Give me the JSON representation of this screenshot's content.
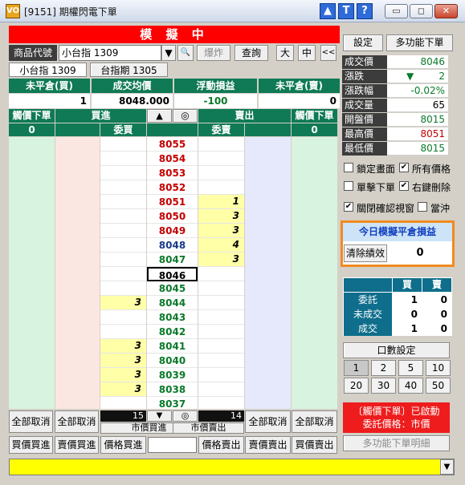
{
  "window": {
    "title": "[9151] 期權閃電下單",
    "logo": "VO",
    "help_icons": [
      "▲",
      "T",
      "?"
    ],
    "controls": [
      "▭",
      "◻",
      "✕"
    ]
  },
  "header": {
    "mode_label": "模 擬 中",
    "product_label": "商品代號",
    "product_value": "小台指 1309",
    "product_dropdown": "▼",
    "search_icon": "🔍",
    "explode_button": "爆炸",
    "query_button": "查詢",
    "size_buttons": [
      "大",
      "中",
      "<<"
    ],
    "tabs": [
      "小台指 1309",
      "台指期 1305"
    ]
  },
  "positions": {
    "headers": [
      "未平倉(買)",
      "成交均價",
      "浮動損益",
      "未平倉(賣)"
    ],
    "values": [
      "1",
      "8048.000",
      "-100",
      "0"
    ]
  },
  "ladder": {
    "left_headers": [
      "觸價下單",
      "買進"
    ],
    "mid_headers": [
      "▲",
      "◎"
    ],
    "right_headers": [
      "賣出",
      "觸價下單"
    ],
    "sub_left": [
      "0",
      "",
      "委買"
    ],
    "sub_right": [
      "委賣",
      "",
      "0"
    ],
    "rows": [
      {
        "price": "8055",
        "color": "#c40000",
        "bid": "",
        "ask": ""
      },
      {
        "price": "8054",
        "color": "#c40000",
        "bid": "",
        "ask": ""
      },
      {
        "price": "8053",
        "color": "#c40000",
        "bid": "",
        "ask": ""
      },
      {
        "price": "8052",
        "color": "#c40000",
        "bid": "",
        "ask": ""
      },
      {
        "price": "8051",
        "color": "#c40000",
        "bid": "",
        "ask": "1"
      },
      {
        "price": "8050",
        "color": "#c40000",
        "bid": "",
        "ask": "3"
      },
      {
        "price": "8049",
        "color": "#c40000",
        "bid": "",
        "ask": "3"
      },
      {
        "price": "8048",
        "color": "#1a3a8a",
        "bid": "",
        "ask": "4"
      },
      {
        "price": "8047",
        "color": "#0a7a2a",
        "bid": "",
        "ask": "3"
      },
      {
        "price": "8046",
        "color": "#000000",
        "bid": "",
        "ask": ""
      },
      {
        "price": "8045",
        "color": "#0a7a2a",
        "bid": "",
        "ask": ""
      },
      {
        "price": "8044",
        "color": "#0a7a2a",
        "bid": "3",
        "ask": ""
      },
      {
        "price": "8043",
        "color": "#0a7a2a",
        "bid": "",
        "ask": ""
      },
      {
        "price": "8042",
        "color": "#0a7a2a",
        "bid": "",
        "ask": ""
      },
      {
        "price": "8041",
        "color": "#0a7a2a",
        "bid": "3",
        "ask": ""
      },
      {
        "price": "8040",
        "color": "#0a7a2a",
        "bid": "3",
        "ask": ""
      },
      {
        "price": "8039",
        "color": "#0a7a2a",
        "bid": "3",
        "ask": ""
      },
      {
        "price": "8038",
        "color": "#0a7a2a",
        "bid": "3",
        "ask": ""
      },
      {
        "price": "8037",
        "color": "#0a7a2a",
        "bid": "",
        "ask": ""
      }
    ]
  },
  "bottom": {
    "cancel_all": "全部取消",
    "buy_total": "15",
    "sell_total": "14",
    "down_arrow": "▼",
    "center_icon": "◎",
    "market_buy": "市價買進",
    "market_sell": "市價賣出",
    "buy_buttons": [
      "買價買進",
      "賣價買進",
      "價格買進"
    ],
    "sell_buttons": [
      "價格賣出",
      "賣價賣出",
      "買價賣出"
    ],
    "price_input": ""
  },
  "right": {
    "settings_button": "設定",
    "multi_order_button": "多功能下單",
    "quote": [
      {
        "label": "成交價",
        "value": "8046",
        "color": "#0a7a2a"
      },
      {
        "label": "漲跌",
        "value": "2",
        "arrow": "▼",
        "color": "#0a7a2a"
      },
      {
        "label": "漲跌幅",
        "value": "-0.02%",
        "color": "#0a7a2a"
      },
      {
        "label": "成交量",
        "value": "65",
        "color": "#000000"
      },
      {
        "label": "開盤價",
        "value": "8015",
        "color": "#0a7a2a"
      },
      {
        "label": "最高價",
        "value": "8051",
        "color": "#c40000"
      },
      {
        "label": "最低價",
        "value": "8015",
        "color": "#0a7a2a"
      }
    ],
    "options": [
      {
        "label": "鎖定畫面",
        "checked": false
      },
      {
        "label": "所有價格",
        "checked": true
      },
      {
        "label": "單擊下單",
        "checked": false
      },
      {
        "label": "右鍵刪除",
        "checked": true
      },
      {
        "label": "關閉確認視窗",
        "checked": true
      },
      {
        "label": "當沖",
        "checked": false
      }
    ],
    "pnl_title": "今日模擬平倉損益",
    "clear_button": "清除績效",
    "pnl_value": "0",
    "stats_headers": [
      "買",
      "賣"
    ],
    "stats": [
      {
        "label": "委託",
        "buy": "1",
        "sell": "0"
      },
      {
        "label": "未成交",
        "buy": "0",
        "sell": "0"
      },
      {
        "label": "成交",
        "buy": "1",
        "sell": "0"
      }
    ],
    "qty_title": "口數設定",
    "qty_buttons": [
      "1",
      "2",
      "5",
      "10",
      "20",
      "30",
      "40",
      "50"
    ],
    "status_line1": "〔觸價下單〕已啟動",
    "status_line2": "委託價格：市價",
    "detail_button": "多功能下單明細"
  },
  "footer": {
    "message": "",
    "dropdown": "▼"
  }
}
